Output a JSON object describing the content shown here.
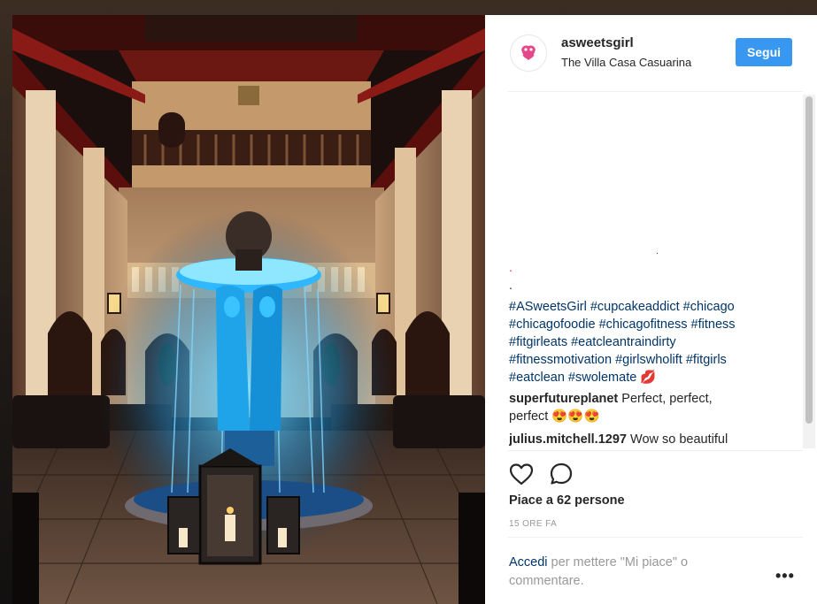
{
  "post": {
    "username": "asweetsgirl",
    "location": "The Villa Casa Casuarina",
    "follow_label": "Segui"
  },
  "caption": {
    "dots": [
      ".",
      ".",
      "."
    ],
    "text_lines": [
      "#ASweetsGirl #cupcakeaddict #chicago",
      "#chicagofoodie #chicagofitness #fitness",
      "#fitgirleats #eatcleantraindirty",
      "#fitnessmotivation #girlswholift #fitgirls",
      "#eatclean #swolemate"
    ],
    "emoji": "💋"
  },
  "comments": [
    {
      "user": "superfutureplanet",
      "lines": [
        "Perfect, perfect,",
        "perfect 😍😍😍"
      ]
    },
    {
      "user": "julius.mitchell.1297",
      "lines": [
        "Wow so beautiful"
      ]
    }
  ],
  "actions": {
    "like_icon": "heart-icon",
    "comment_icon": "comment-icon",
    "likes_text": "Piace a 62 persone",
    "time_ago": "15 ORE FA"
  },
  "footer": {
    "login_link": "Accedi",
    "login_text": " per mettere \"Mi piace\" o commentare.",
    "more_label": "•••"
  },
  "colors": {
    "follow_button": "#3897f0",
    "hashtag": "#003569",
    "fountain_glow": "#2fb8ff"
  }
}
